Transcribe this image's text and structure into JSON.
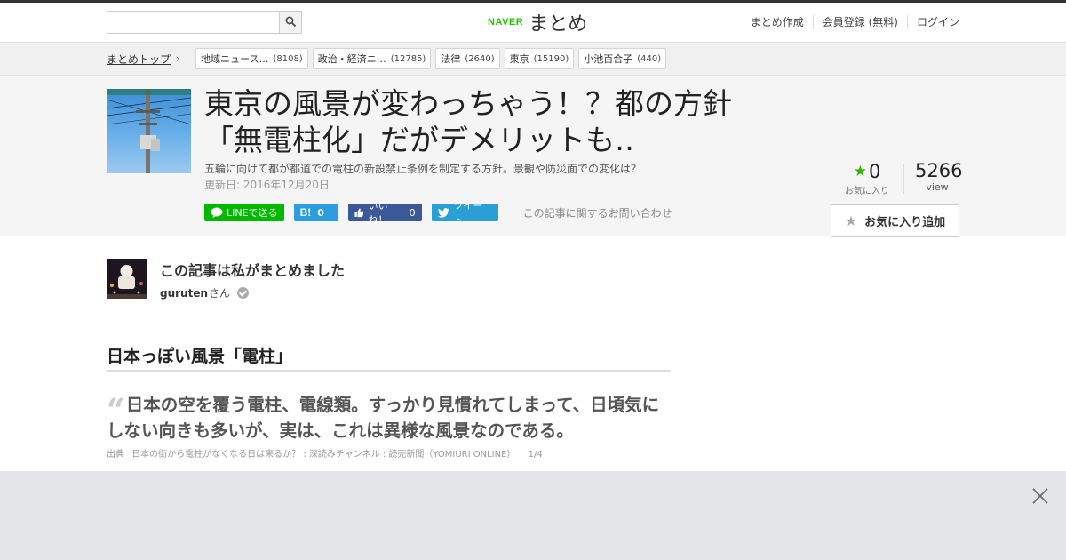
{
  "header": {
    "search_placeholder": "",
    "logo_brand": "NAVER",
    "logo_text": "まとめ",
    "nav": [
      "まとめ作成",
      "会員登録 (無料)",
      "ログイン"
    ]
  },
  "breadcrumb": {
    "home": "まとめトップ",
    "tags": [
      {
        "label": "地域ニュース…",
        "count": "(8108)"
      },
      {
        "label": "政治・経済ニ…",
        "count": "(12785)"
      },
      {
        "label": "法律",
        "count": "(2640)"
      },
      {
        "label": "東京",
        "count": "(15190)"
      },
      {
        "label": "小池百合子",
        "count": "(440)"
      }
    ]
  },
  "article": {
    "title_line1": "東京の風景が変わっちゃう！？都の方針",
    "title_line2": "「無電柱化」だがデメリットも‥",
    "description": "五輪に向けて都が都道での電柱の新設禁止条例を制定する方針。景観や防災面での変化は？",
    "updated": "更新日: 2016年12月20日",
    "favorites_count": "0",
    "favorites_label": "お気に入り",
    "views_count": "5266",
    "views_label": "view",
    "favorite_button": "お気に入り追加"
  },
  "share": {
    "line": "LINEで送る",
    "hatena_count": "0",
    "facebook_label": "いいね！",
    "facebook_count": "0",
    "twitter": "ツイート",
    "inquiry": "この記事に関するお問い合わせ"
  },
  "author": {
    "heading": "この記事は私がまとめました",
    "name": "guruten",
    "suffix": "さん"
  },
  "content": {
    "section_title": "日本っぽい風景「電柱」",
    "quote": "日本の空を覆う電柱、電線類。すっかり見慣れてしまって、日頃気にしない向きも多いが、実は、これは異様な風景なのである。",
    "source_prefix": "出典",
    "source_text": "日本の街から電柱がなくなる日は来るか？ : 深読みチャンネル : 読売新聞（YOMIURI ONLINE）",
    "source_page": "1/4"
  },
  "colors": {
    "naver_green": "#1ec800",
    "line_green": "#00b900",
    "hatena_blue": "#2c9ee0",
    "facebook_blue": "#3b5998",
    "twitter_blue": "#2a9fd6"
  }
}
